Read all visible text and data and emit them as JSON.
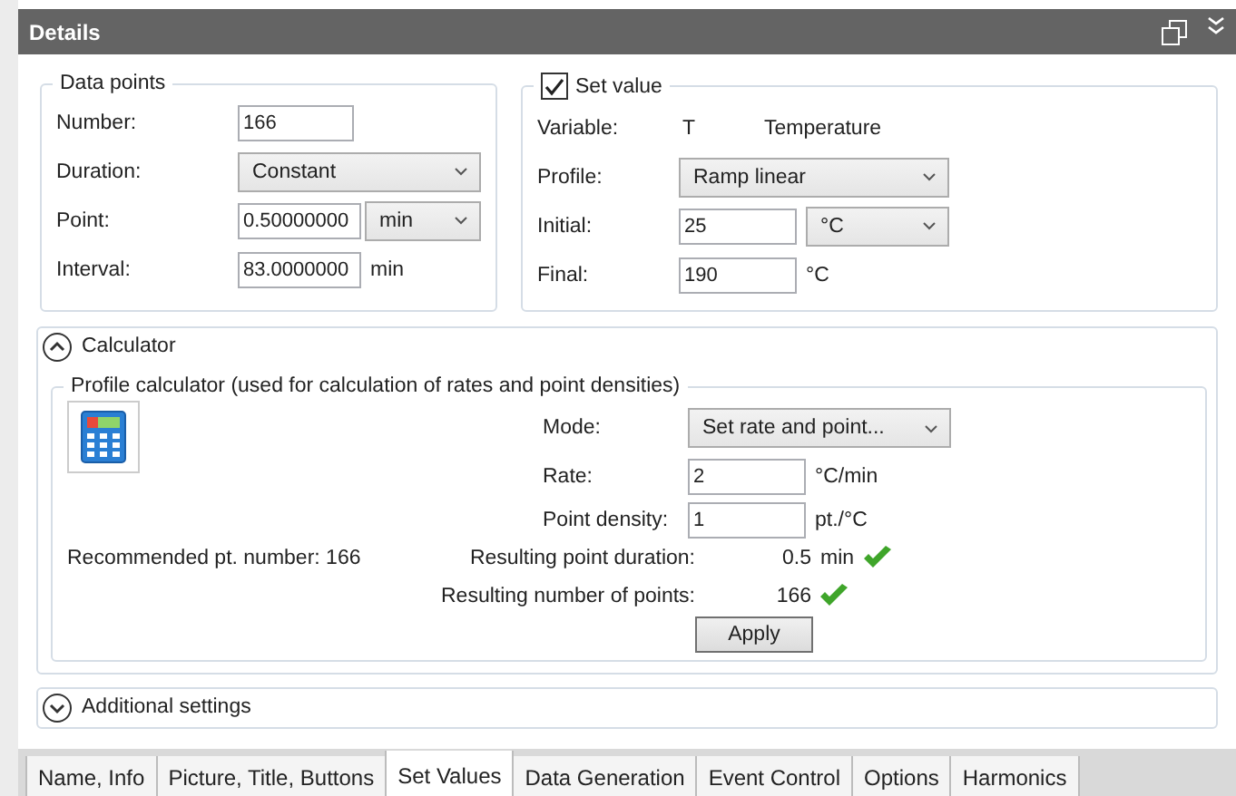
{
  "window": {
    "title": "Details"
  },
  "data_points": {
    "title": "Data points",
    "fields": [
      {
        "kind": "input",
        "label": "Number:",
        "value": "166"
      },
      {
        "kind": "select",
        "label": "Duration:",
        "value": "Constant"
      },
      {
        "kind": "input_select",
        "label": "Point:",
        "value": "0.50000000",
        "unit": "min"
      },
      {
        "kind": "input_unit",
        "label": "Interval:",
        "value": "83.0000000",
        "unit": "min"
      }
    ]
  },
  "set_value": {
    "title": "Set value",
    "checked": true,
    "fields": [
      {
        "kind": "text",
        "label": "Variable:",
        "value": "T",
        "unit": "Temperature"
      },
      {
        "kind": "select",
        "label": "Profile:",
        "value": "Ramp linear"
      },
      {
        "kind": "input_select",
        "label": "Initial:",
        "value": "25",
        "unit": "°C"
      },
      {
        "kind": "input_unit",
        "label": "Final:",
        "value": "190",
        "unit": "°C"
      }
    ]
  },
  "calculator": {
    "title": "Calculator",
    "expanded": true,
    "group_title": "Profile calculator (used for calculation of rates and point densities)",
    "fields": [
      {
        "kind": "select",
        "label": "Mode:",
        "value": "Set rate and point..."
      },
      {
        "kind": "input_unit",
        "label": "Rate:",
        "value": "2",
        "unit": "°C/min"
      },
      {
        "kind": "input_unit",
        "label": "Point density:",
        "value": "1",
        "unit": "pt./°C"
      }
    ],
    "recommended": "Recommended pt. number: 166",
    "results": [
      {
        "label": "Resulting point duration:",
        "value": "0.5",
        "unit": "min",
        "ok": true
      },
      {
        "label": "Resulting number of points:",
        "value": "166",
        "ok": true
      }
    ],
    "apply": "Apply"
  },
  "additional_settings": {
    "title": "Additional settings",
    "expanded": false
  },
  "tabs": [
    {
      "label": "Name, Info",
      "selected": false
    },
    {
      "label": "Picture, Title, Buttons",
      "selected": false
    },
    {
      "label": "Set Values",
      "selected": true
    },
    {
      "label": "Data Generation",
      "selected": false
    },
    {
      "label": "Event Control",
      "selected": false
    },
    {
      "label": "Options",
      "selected": false
    },
    {
      "label": "Harmonics",
      "selected": false
    }
  ]
}
